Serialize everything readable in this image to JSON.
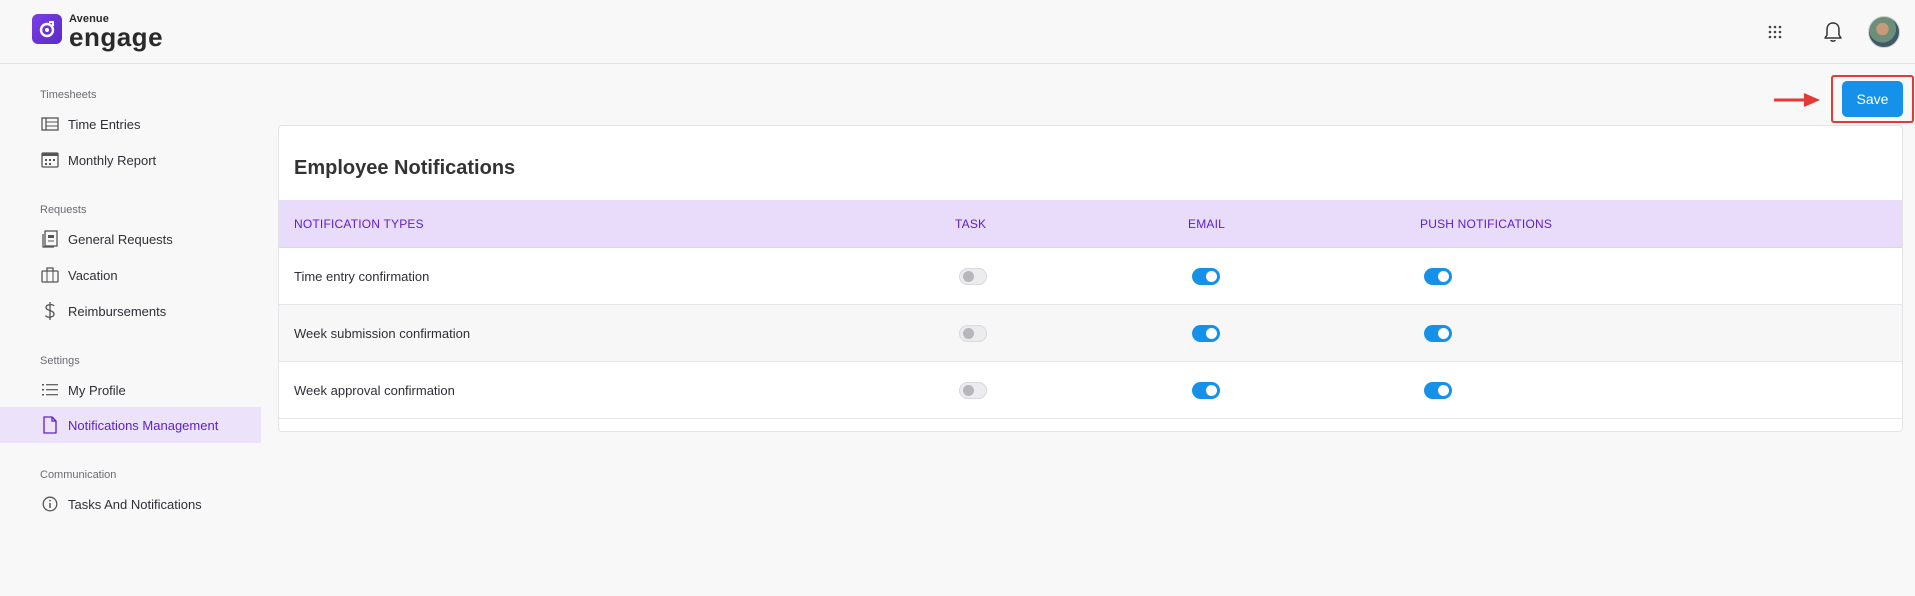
{
  "app": {
    "brand_top": "Avenue",
    "brand_main": "engage"
  },
  "header": {
    "icons": [
      "apps-grid-icon",
      "bell-icon",
      "user-avatar"
    ]
  },
  "sidebar": {
    "sections": [
      {
        "title": "Timesheets",
        "items": [
          {
            "label": "Time Entries",
            "icon": "list-icon"
          },
          {
            "label": "Monthly Report",
            "icon": "calendar-icon"
          }
        ]
      },
      {
        "title": "Requests",
        "items": [
          {
            "label": "General Requests",
            "icon": "form-icon"
          },
          {
            "label": "Vacation",
            "icon": "suitcase-icon"
          },
          {
            "label": "Reimbursements",
            "icon": "dollar-icon"
          }
        ]
      },
      {
        "title": "Settings",
        "items": [
          {
            "label": "My Profile",
            "icon": "bullet-list-icon"
          },
          {
            "label": "Notifications Management",
            "icon": "document-icon",
            "active": true
          }
        ]
      },
      {
        "title": "Communication",
        "items": [
          {
            "label": "Tasks And Notifications",
            "icon": "info-icon"
          }
        ]
      }
    ]
  },
  "toolbar": {
    "save_label": "Save"
  },
  "card": {
    "title": "Employee Notifications",
    "columns": [
      "NOTIFICATION TYPES",
      "TASK",
      "EMAIL",
      "PUSH NOTIFICATIONS"
    ],
    "rows": [
      {
        "label": "Time entry confirmation",
        "task": false,
        "email": true,
        "push": true
      },
      {
        "label": "Week submission confirmation",
        "task": false,
        "email": true,
        "push": true
      },
      {
        "label": "Week approval confirmation",
        "task": false,
        "email": true,
        "push": true
      }
    ]
  },
  "colors": {
    "accent_purple": "#5b21c9",
    "header_row_bg": "#e9dcfa",
    "toggle_on": "#1591ea",
    "highlight_red": "#e53935"
  }
}
